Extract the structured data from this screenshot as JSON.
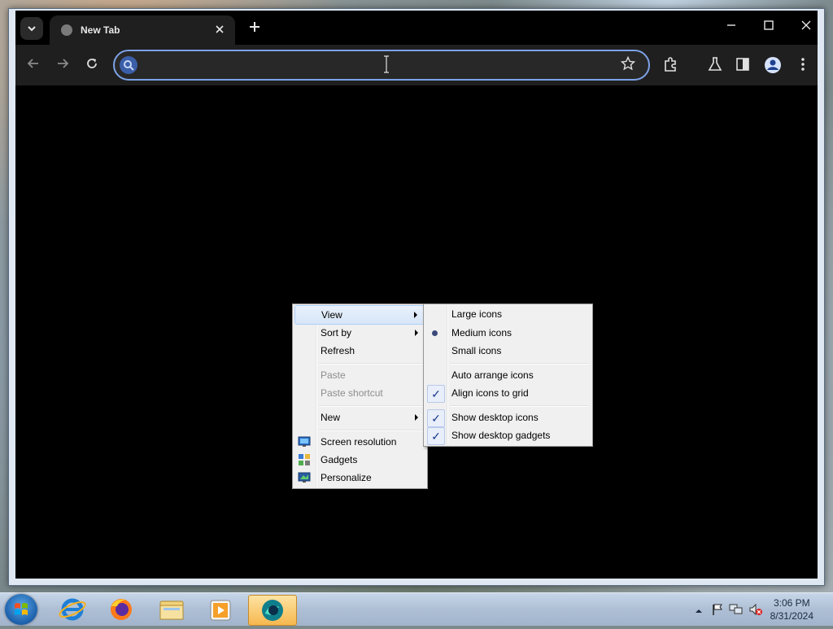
{
  "browser": {
    "tab_title": "New Tab",
    "omnibox_value": "",
    "omnibox_placeholder": ""
  },
  "desktop_menu": {
    "items": [
      {
        "label": "View",
        "submenu": true,
        "highlighted": true,
        "disabled": false
      },
      {
        "label": "Sort by",
        "submenu": true,
        "disabled": false
      },
      {
        "label": "Refresh",
        "disabled": false
      },
      {
        "label": "Paste",
        "disabled": true
      },
      {
        "label": "Paste shortcut",
        "disabled": true
      },
      {
        "label": "New",
        "submenu": true,
        "disabled": false
      },
      {
        "label": "Screen resolution",
        "icon": "screen-resolution-icon"
      },
      {
        "label": "Gadgets",
        "icon": "gadgets-icon"
      },
      {
        "label": "Personalize",
        "icon": "personalize-icon"
      }
    ]
  },
  "view_submenu": {
    "items": [
      {
        "label": "Large icons",
        "state": "none"
      },
      {
        "label": "Medium icons",
        "state": "radio"
      },
      {
        "label": "Small icons",
        "state": "none"
      },
      {
        "label": "Auto arrange icons",
        "state": "none"
      },
      {
        "label": "Align icons to grid",
        "state": "checked"
      },
      {
        "label": "Show desktop icons",
        "state": "checked"
      },
      {
        "label": "Show desktop gadgets",
        "state": "checked"
      }
    ]
  },
  "taskbar": {
    "pinned": [
      "internet-explorer-icon",
      "firefox-icon",
      "file-explorer-icon",
      "media-player-icon",
      "app-icon"
    ],
    "tray": {
      "time": "3:06 PM",
      "date": "8/31/2024"
    }
  },
  "colors": {
    "omnibox_focus": "#7da2e8",
    "menu_bg": "#f0f0f0",
    "taskbar_active": "#f7b84e"
  }
}
